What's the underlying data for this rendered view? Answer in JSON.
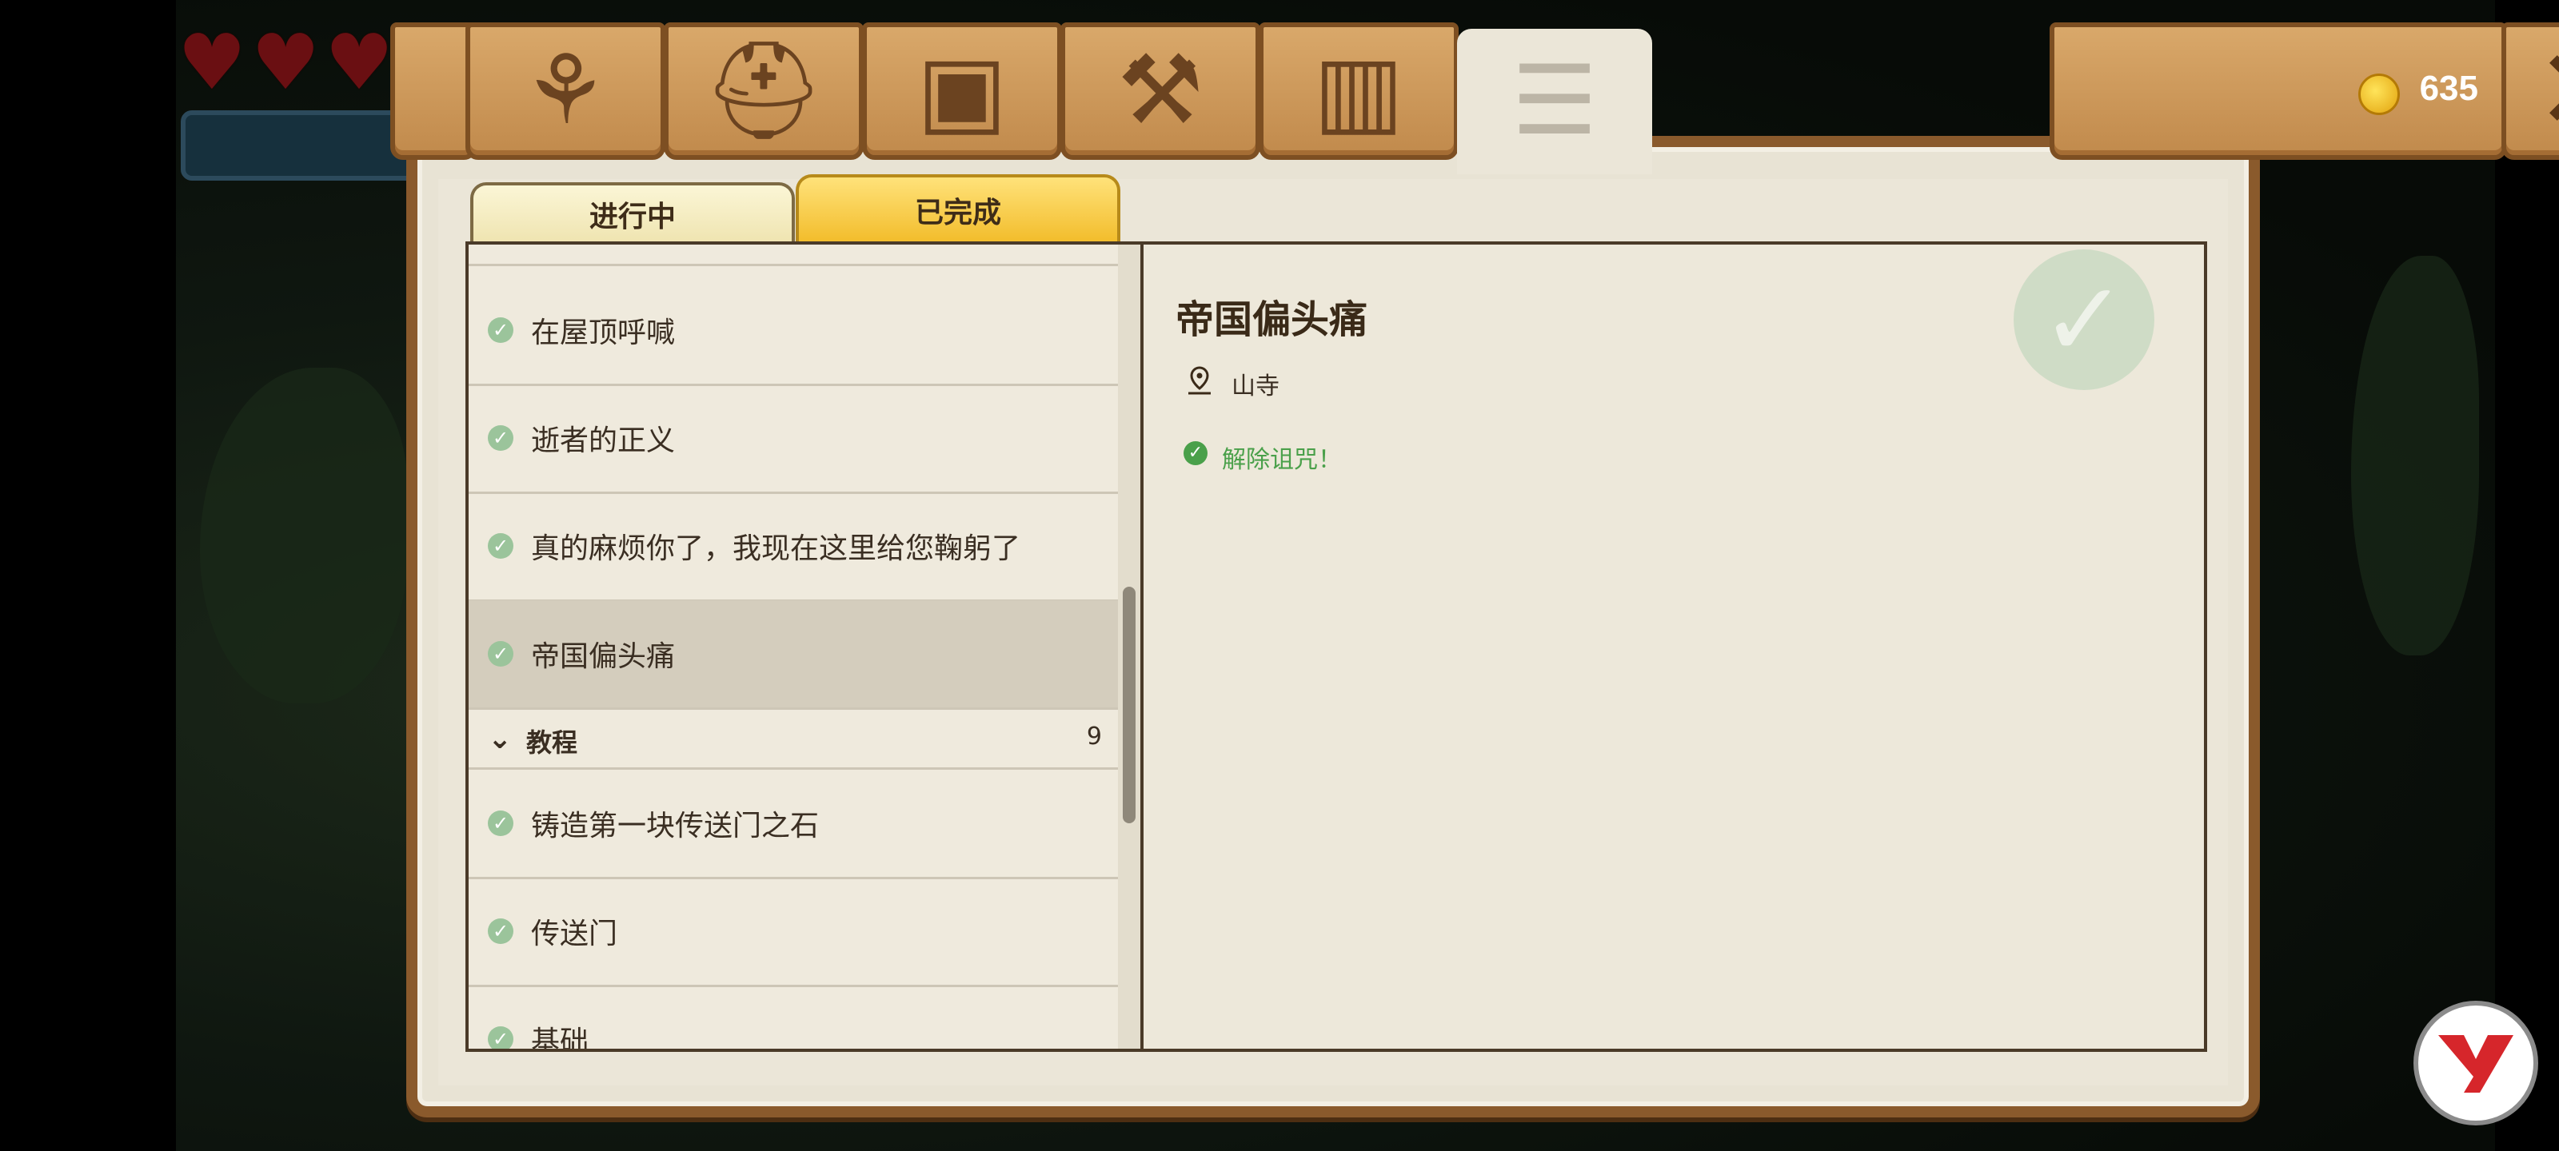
{
  "hud": {
    "hearts": [
      "♥",
      "♥",
      "♥"
    ]
  },
  "top_tabs": [
    {
      "name": "skill-tree",
      "icon": "⚘"
    },
    {
      "name": "equipment",
      "icon": "⛑"
    },
    {
      "name": "inventory",
      "icon": "▣"
    },
    {
      "name": "crafting",
      "icon": "⚒"
    },
    {
      "name": "map",
      "icon": "▥"
    },
    {
      "name": "quests",
      "icon": "☰"
    }
  ],
  "currency": {
    "amount": "635"
  },
  "close_icon": "✕",
  "sub_tabs": {
    "in_progress": "进行中",
    "completed": "已完成"
  },
  "quest_list": {
    "items_top": [
      {
        "label": "在屋顶呼喊"
      },
      {
        "label": "逝者的正义"
      },
      {
        "label": "真的麻烦你了，我现在这里给您鞠躬了"
      },
      {
        "label": "帝国偏头痛",
        "selected": true
      }
    ],
    "section": {
      "label": "教程",
      "count": "9"
    },
    "items_bottom": [
      {
        "label": "铸造第一块传送门之石"
      },
      {
        "label": "传送门"
      },
      {
        "label": "基础"
      }
    ]
  },
  "detail": {
    "title": "帝国偏头痛",
    "location": "山寺",
    "objective": "解除诅咒！"
  },
  "colors": {
    "accent_gold": "#f2bc2a",
    "wood": "#c18a4c",
    "success_green": "#4aa04a"
  }
}
